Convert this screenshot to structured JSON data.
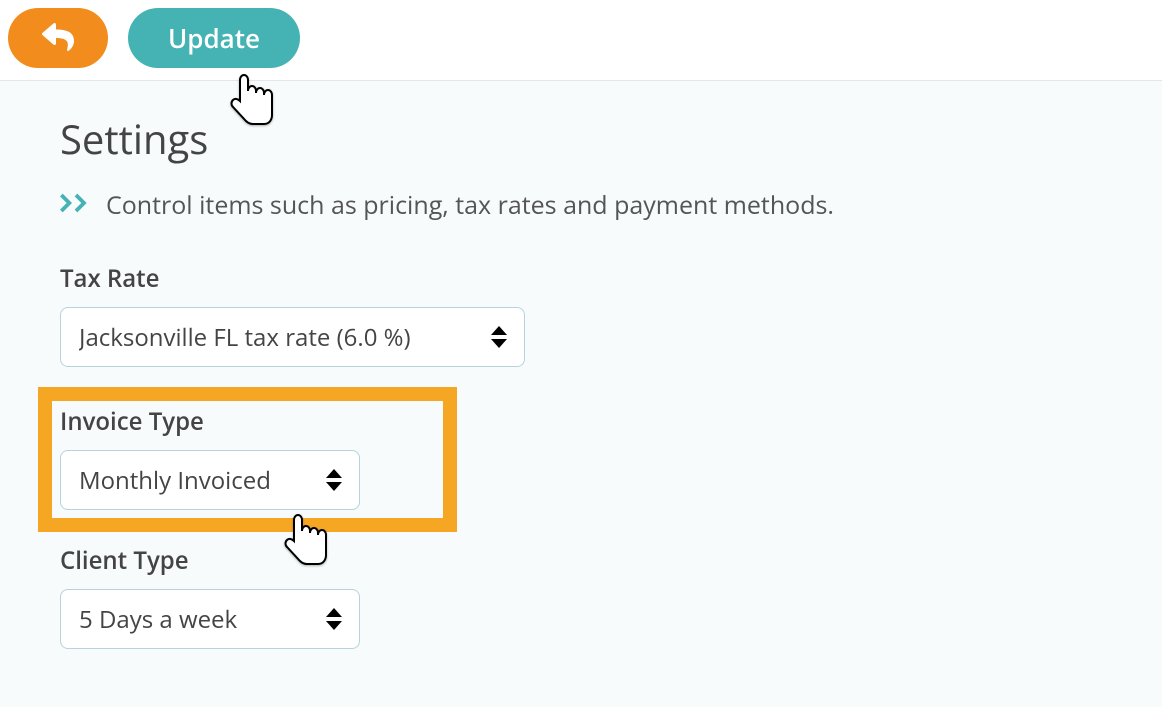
{
  "toolbar": {
    "update_label": "Update"
  },
  "page": {
    "title": "Settings",
    "subtitle": "Control items such as pricing, tax rates and payment methods."
  },
  "fields": {
    "tax_rate": {
      "label": "Tax Rate",
      "value": "Jacksonville FL tax rate (6.0 %)"
    },
    "invoice_type": {
      "label": "Invoice Type",
      "value": "Monthly Invoiced"
    },
    "client_type": {
      "label": "Client Type",
      "value": "5 Days a week"
    }
  }
}
